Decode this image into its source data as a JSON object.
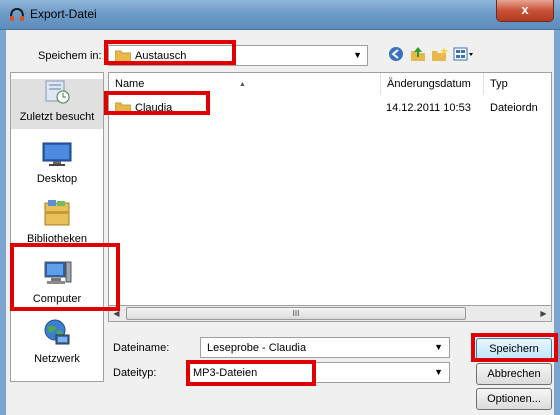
{
  "window": {
    "title": "Export-Datei",
    "close_glyph": "x"
  },
  "toolbar": {
    "save_in_label": "Speichem in:",
    "save_in_value": "Austausch",
    "icons": [
      "back-icon",
      "up-folder-icon",
      "new-folder-icon",
      "view-menu-icon"
    ]
  },
  "places": [
    {
      "label": "Zuletzt besucht",
      "icon": "recent-places-icon"
    },
    {
      "label": "Desktop",
      "icon": "desktop-icon"
    },
    {
      "label": "Bibliotheken",
      "icon": "libraries-icon"
    },
    {
      "label": "Computer",
      "icon": "computer-icon"
    },
    {
      "label": "Netzwerk",
      "icon": "network-icon"
    }
  ],
  "filelist": {
    "columns": [
      "Name",
      "Änderungsdatum",
      "Typ"
    ],
    "rows": [
      {
        "name": "Claudia",
        "date": "14.12.2011 10:53",
        "type": "Dateiordn"
      }
    ],
    "scroll_thumb_glyph": "III"
  },
  "form": {
    "filename_label": "Dateiname:",
    "filename_value": "Leseprobe - Claudia",
    "filetype_label": "Dateityp:",
    "filetype_value": "MP3-Dateien"
  },
  "buttons": {
    "save": "Speichern",
    "cancel": "Abbrechen",
    "options": "Optionen..."
  },
  "colors": {
    "highlight": "#e10000",
    "folder": "#e8b84a"
  }
}
